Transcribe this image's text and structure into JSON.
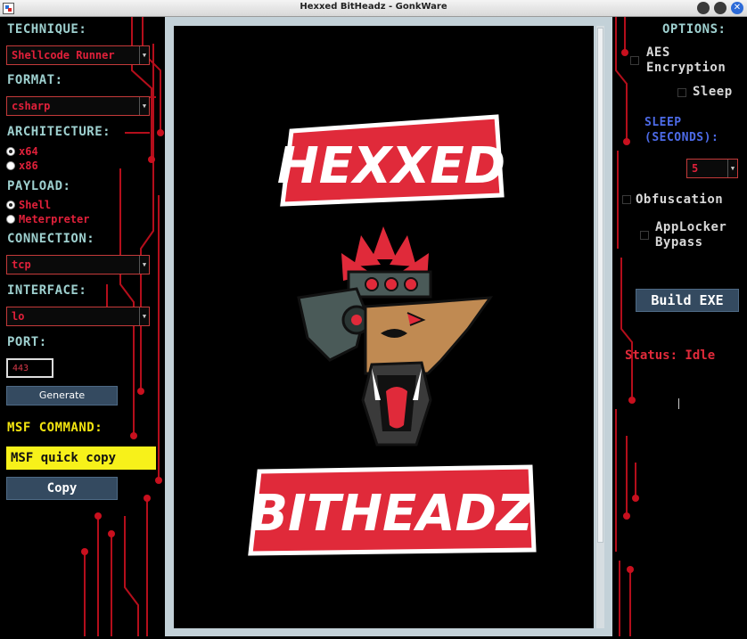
{
  "window": {
    "title": "Hexxed BitHeadz - GonkWare"
  },
  "left": {
    "technique_label": "TECHNIQUE:",
    "technique_value": "Shellcode Runner",
    "format_label": "FORMAT:",
    "format_value": "csharp",
    "architecture_label": "ARCHITECTURE:",
    "architecture_options": [
      {
        "label": "x64",
        "selected": true
      },
      {
        "label": "x86",
        "selected": false
      }
    ],
    "payload_label": "PAYLOAD:",
    "payload_options": [
      {
        "label": "Shell",
        "selected": true
      },
      {
        "label": "Meterpreter",
        "selected": false
      }
    ],
    "connection_label": "CONNECTION:",
    "connection_value": "tcp",
    "interface_label": "INTERFACE:",
    "interface_value": "lo",
    "port_label": "PORT:",
    "port_value": "443",
    "generate_label": "Generate",
    "msf_command_label": "MSF COMMAND:",
    "msf_quick_copy": "MSF quick copy",
    "copy_label": "Copy"
  },
  "center": {
    "logo_top": "HEXXED",
    "logo_bottom": "BITHEADZ"
  },
  "right": {
    "options_label": "OPTIONS:",
    "aes_label_1": "AES",
    "aes_label_2": "Encryption",
    "sleep_label": "Sleep",
    "sleep_seconds_label_1": "SLEEP",
    "sleep_seconds_label_2": "(SECONDS):",
    "sleep_value": "5",
    "obfuscation_label": "Obfuscation",
    "applocker_label_1": "AppLocker",
    "applocker_label_2": "Bypass",
    "build_label": "Build EXE",
    "status_text": "Status: Idle"
  },
  "colors": {
    "accent_red": "#e0203a",
    "label_teal": "#9ed0cf",
    "label_yellow": "#f2e410",
    "button_bg": "#344a60"
  }
}
